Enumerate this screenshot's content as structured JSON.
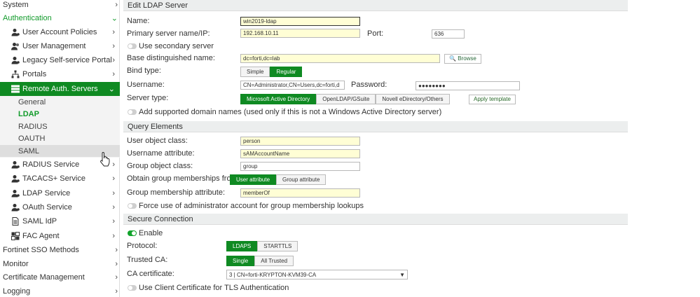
{
  "sidebar": {
    "system": "System",
    "authentication": "Authentication",
    "user_account_policies": "User Account Policies",
    "user_management": "User Management",
    "legacy_portal": "Legacy Self-service Portal",
    "portals": "Portals",
    "remote_auth": "Remote Auth. Servers",
    "general": "General",
    "ldap": "LDAP",
    "radius": "RADIUS",
    "oauth": "OAUTH",
    "saml": "SAML",
    "radius_service": "RADIUS Service",
    "tacacs_service": "TACACS+ Service",
    "ldap_service": "LDAP Service",
    "oauth_service": "OAuth Service",
    "saml_idp": "SAML IdP",
    "fac_agent": "FAC Agent",
    "fortinet_sso": "Fortinet SSO Methods",
    "monitor": "Monitor",
    "certificate_mgmt": "Certificate Management",
    "logging": "Logging",
    "chevron": "›",
    "chevron_open": "⌄"
  },
  "form": {
    "header": "Edit LDAP Server",
    "name_label": "Name:",
    "name_value": "win2019-ldap",
    "primary_label": "Primary server name/IP:",
    "primary_value": "192.168.10.11",
    "port_label": "Port:",
    "port_value": "636",
    "secondary_label": "Use secondary server",
    "basedn_label": "Base distinguished name:",
    "basedn_value": "dc=forti,dc=lab",
    "browse_label": "Browse",
    "bind_label": "Bind type:",
    "bind_simple": "Simple",
    "bind_regular": "Regular",
    "username_label": "Username:",
    "username_value": "CN=Administrator,CN=Users,dc=forti,d",
    "password_label": "Password:",
    "password_value": "●●●●●●●●",
    "servertype_label": "Server type:",
    "st_ad": "Microsoft Active Directory",
    "st_openldap": "OpenLDAP/GSuite",
    "st_novell": "Novell eDirectory/Others",
    "apply_template": "Apply template",
    "domain_names_label": "Add supported domain names (used only if this is not a Windows Active Directory server)"
  },
  "query": {
    "header": "Query Elements",
    "user_oc_label": "User object class:",
    "user_oc_value": "person",
    "username_attr_label": "Username attribute:",
    "username_attr_value": "sAMAccountName",
    "group_oc_label": "Group object class:",
    "group_oc_value": "group",
    "obtain_label": "Obtain group memberships from:",
    "obtain_user": "User attribute",
    "obtain_group": "Group attribute",
    "gm_attr_label": "Group membership attribute:",
    "gm_attr_value": "memberOf",
    "force_admin_label": "Force use of administrator account for group membership lookups"
  },
  "secure": {
    "header": "Secure Connection",
    "enable_label": "Enable",
    "protocol_label": "Protocol:",
    "ldaps": "LDAPS",
    "starttls": "STARTTLS",
    "trusted_label": "Trusted CA:",
    "single": "Single",
    "all_trusted": "All Trusted",
    "ca_label": "CA certificate:",
    "ca_value": "3 | CN=forti-KRYPTON-KVM39-CA",
    "client_cert_label": "Use Client Certificate for TLS Authentication"
  },
  "colors": {
    "accent_green": "#0f8a22",
    "sidebar_active": "#0f8a22",
    "input_yellow": "#fffed5"
  }
}
